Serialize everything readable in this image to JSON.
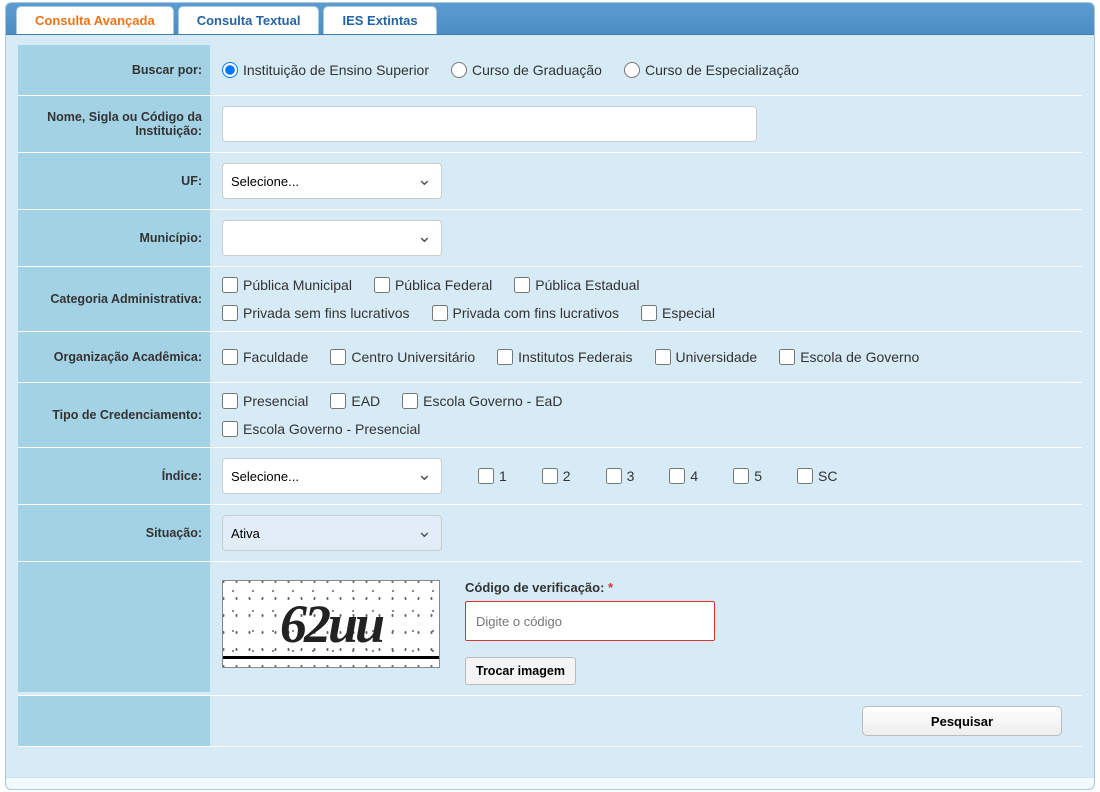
{
  "tabs": {
    "advanced": "Consulta Avançada",
    "textual": "Consulta Textual",
    "extinct": "IES Extintas"
  },
  "labels": {
    "buscar_por": "Buscar por:",
    "nome": "Nome, Sigla ou Código da Instituição:",
    "uf": "UF:",
    "municipio": "Município:",
    "categoria": "Categoria Administrativa:",
    "org": "Organização Acadêmica:",
    "cred": "Tipo de Credenciamento:",
    "indice": "Índice:",
    "situacao": "Situação:"
  },
  "buscar_por_options": {
    "ies": "Instituição de Ensino Superior",
    "grad": "Curso de Graduação",
    "espec": "Curso de Especialização"
  },
  "uf_placeholder": "Selecione...",
  "categoria_options": {
    "pub_mun": "Pública Municipal",
    "pub_fed": "Pública Federal",
    "pub_est": "Pública Estadual",
    "priv_sem": "Privada sem fins lucrativos",
    "priv_com": "Privada com fins lucrativos",
    "especial": "Especial"
  },
  "org_options": {
    "fac": "Faculdade",
    "centro": "Centro Universitário",
    "inst": "Institutos Federais",
    "univ": "Universidade",
    "esc_gov": "Escola de Governo"
  },
  "cred_options": {
    "pres": "Presencial",
    "ead": "EAD",
    "esc_ead": "Escola Governo - EaD",
    "esc_pres": "Escola Governo - Presencial"
  },
  "indice_placeholder": "Selecione...",
  "indice_checks": {
    "i1": "1",
    "i2": "2",
    "i3": "3",
    "i4": "4",
    "i5": "5",
    "sc": "SC"
  },
  "situacao_value": "Ativa",
  "captcha": {
    "text": "62uu",
    "label": "Código de verificação:",
    "required": "*",
    "placeholder": "Digite o código",
    "swap": "Trocar imagem"
  },
  "search_button": "Pesquisar"
}
